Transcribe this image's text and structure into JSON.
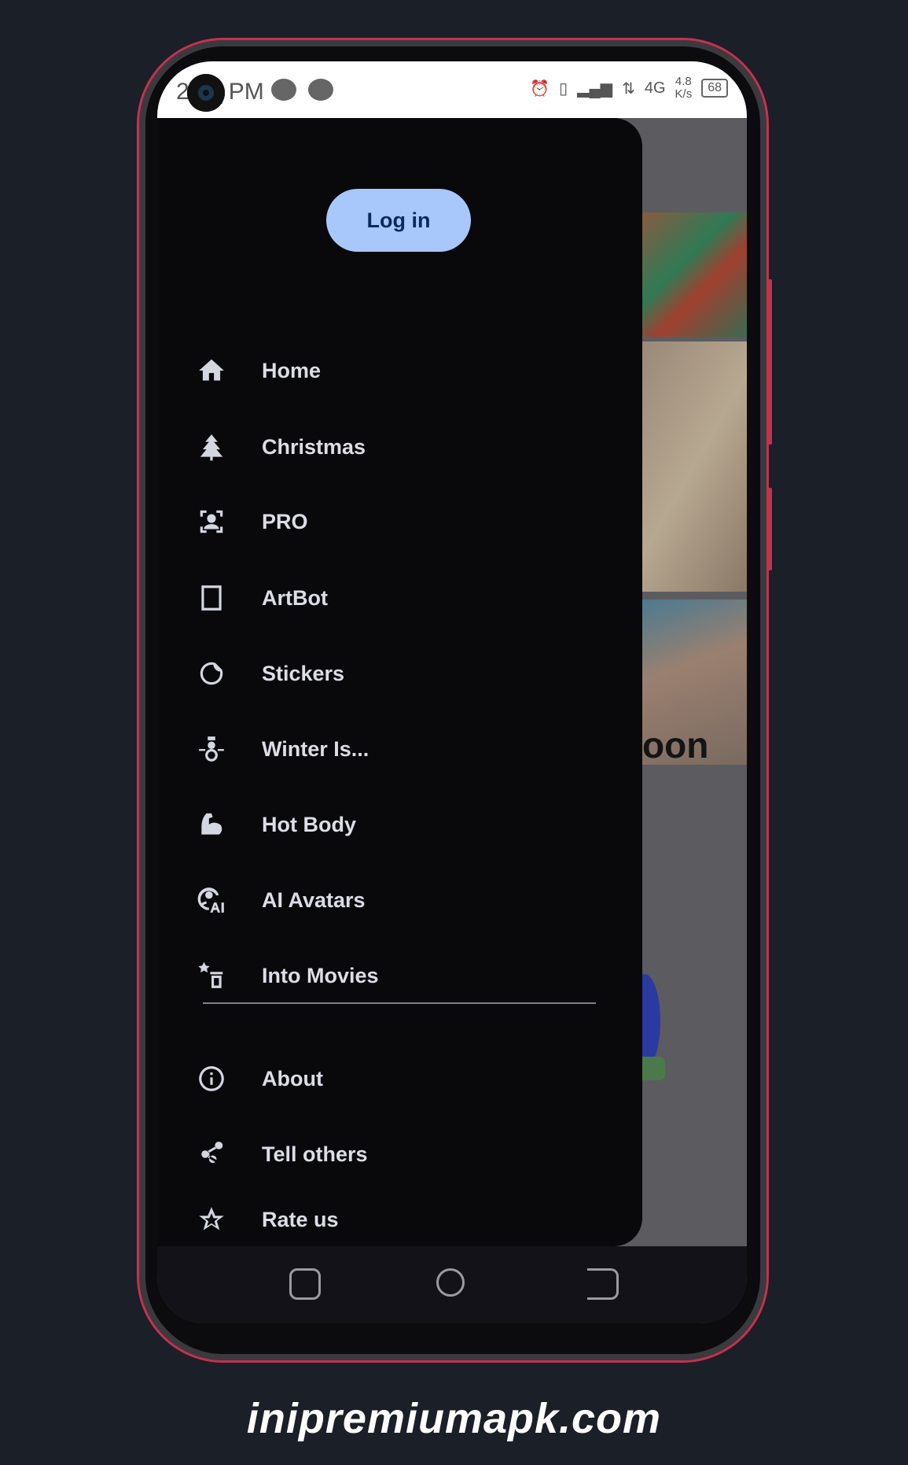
{
  "status_bar": {
    "time": "2:__ PM",
    "network": "4G",
    "speed": "4.8",
    "speed_unit": "K/s",
    "battery": "68"
  },
  "background": {
    "partial_title": "oon"
  },
  "drawer": {
    "login_label": "Log in",
    "items": [
      {
        "label": "Home",
        "icon": "home-icon"
      },
      {
        "label": "Christmas",
        "icon": "tree-icon"
      },
      {
        "label": "PRO",
        "icon": "face-frame-icon"
      },
      {
        "label": "ArtBot",
        "icon": "square-icon"
      },
      {
        "label": "Stickers",
        "icon": "sticker-icon"
      },
      {
        "label": "Winter Is...",
        "icon": "snowman-icon"
      },
      {
        "label": "Hot Body",
        "icon": "muscle-icon"
      },
      {
        "label": "AI Avatars",
        "icon": "ai-avatar-icon"
      },
      {
        "label": "Into Movies",
        "icon": "movie-icon"
      }
    ],
    "secondary_items": [
      {
        "label": "About",
        "icon": "info-icon"
      },
      {
        "label": "Tell others",
        "icon": "share-icon"
      },
      {
        "label": "Rate us",
        "icon": "star-icon"
      }
    ]
  },
  "watermark": "inipremiumapk.com",
  "colors": {
    "accent": "#a8c7fa",
    "drawer": "#09090c",
    "frame": "#c4324e"
  }
}
